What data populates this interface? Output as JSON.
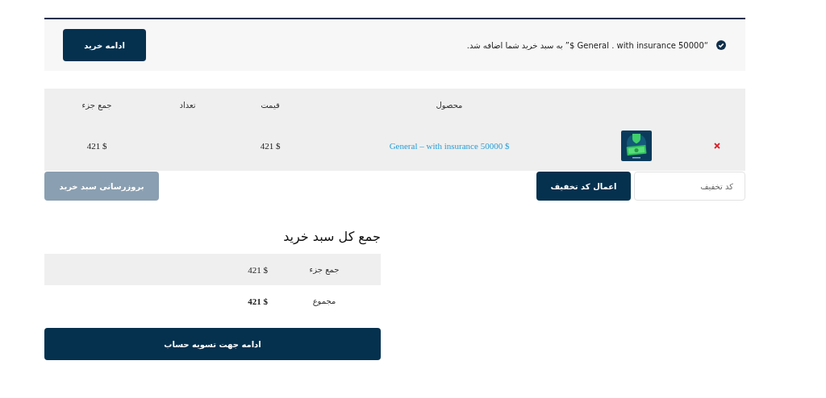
{
  "notice": {
    "checked": true,
    "message": "“General . with insurance 50000 $” به سبد خرید شما اضافه شد.",
    "button": "ادامه خرید"
  },
  "cart": {
    "columns": [
      "محصول",
      "قیمت",
      "تعداد",
      "جمع جزء"
    ],
    "rows": [
      {
        "product": "General – with insurance 50000 $",
        "price": "421 $",
        "subtotal": "421 $"
      }
    ]
  },
  "coupon": {
    "placeholder": "کد تخفیف",
    "apply_button": "اعمال کد تخفیف",
    "update_button": {
      "label": "بروزرسانی سبد خرید",
      "disabled": true
    }
  },
  "totals": {
    "title": "جمع کل سبد خرید",
    "rows": [
      {
        "label": "جمع جزء",
        "value": "421 $",
        "bold": false
      },
      {
        "label": "مجموع",
        "value": "421 $",
        "bold": true
      }
    ],
    "checkout_button": "ادامه جهت تسویه حساب"
  }
}
